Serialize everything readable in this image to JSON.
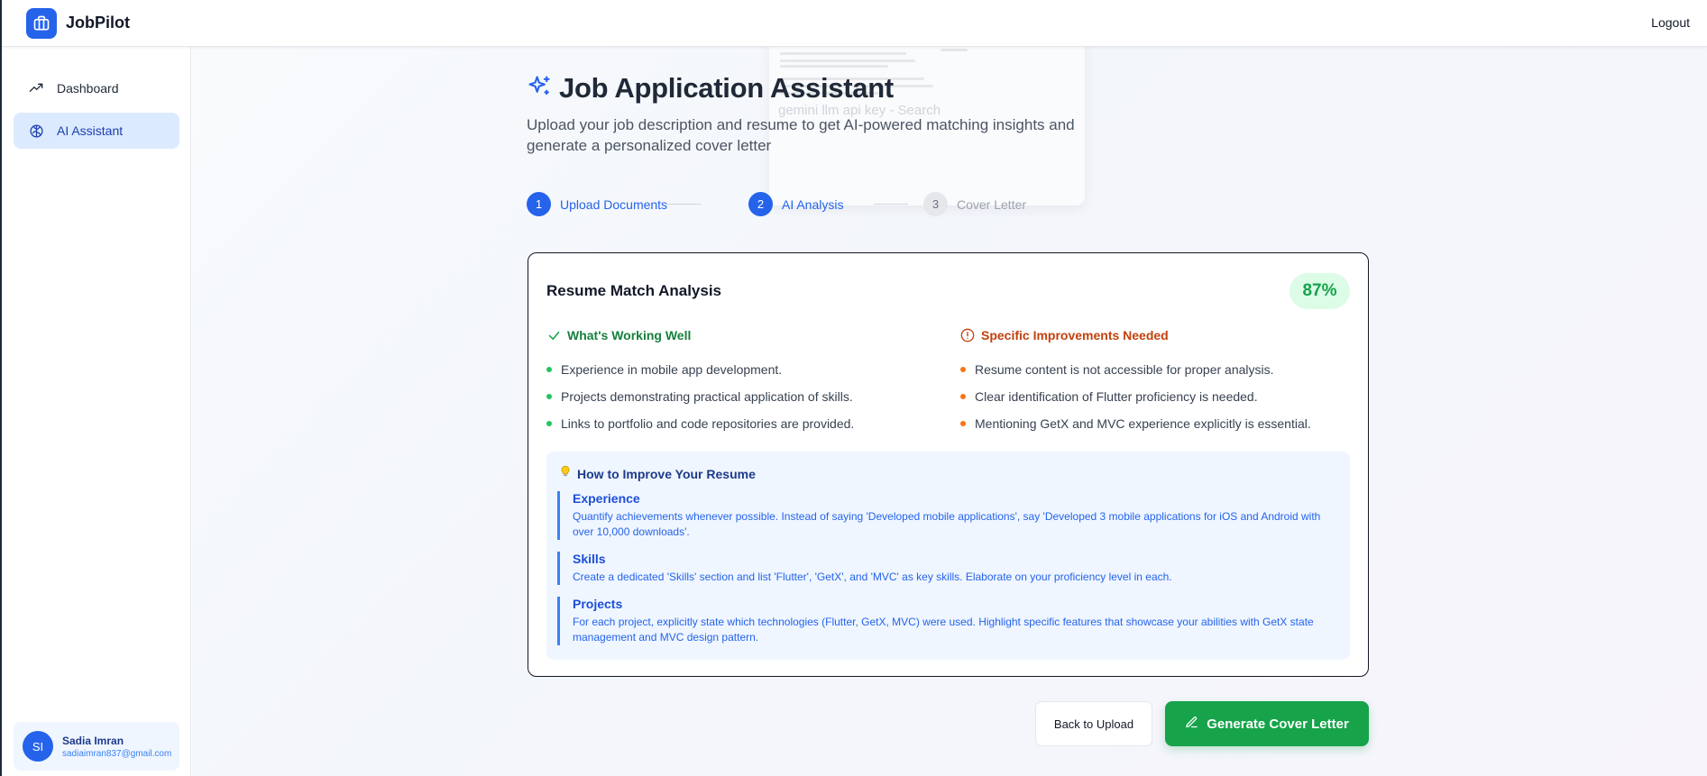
{
  "app": {
    "name": "JobPilot",
    "logout_label": "Logout"
  },
  "sidebar": {
    "items": [
      {
        "label": "Dashboard",
        "icon": "trending-up-icon",
        "active": false
      },
      {
        "label": "AI Assistant",
        "icon": "brain-icon",
        "active": true
      }
    ],
    "user": {
      "initials": "SI",
      "name": "Sadia Imran",
      "email": "sadiaimran837@gmail.com"
    }
  },
  "overlay_ghost": {
    "query_text": "gemini llm api key - Search"
  },
  "page": {
    "title": "Job Application Assistant",
    "subtitle": "Upload your job description and resume to get AI-powered matching insights and generate a personalized cover letter"
  },
  "steps": [
    {
      "number": "1",
      "label": "Upload Documents",
      "state": "active"
    },
    {
      "number": "2",
      "label": "AI Analysis",
      "state": "active"
    },
    {
      "number": "3",
      "label": "Cover Letter",
      "state": "inactive"
    }
  ],
  "analysis": {
    "title": "Resume Match Analysis",
    "score": "87%",
    "strengths": {
      "heading": "What's Working Well",
      "items": [
        "Experience in mobile app development.",
        "Projects demonstrating practical application of skills.",
        "Links to portfolio and code repositories are provided."
      ]
    },
    "improvements": {
      "heading": "Specific Improvements Needed",
      "items": [
        "Resume content is not accessible for proper analysis.",
        "Clear identification of Flutter proficiency is needed.",
        "Mentioning GetX and MVC experience explicitly is essential."
      ]
    },
    "tips": {
      "heading": "How to Improve Your Resume",
      "items": [
        {
          "title": "Experience",
          "body": "Quantify achievements whenever possible. Instead of saying 'Developed mobile applications', say 'Developed 3 mobile applications for iOS and Android with over 10,000 downloads'."
        },
        {
          "title": "Skills",
          "body": "Create a dedicated 'Skills' section and list 'Flutter', 'GetX', and 'MVC' as key skills. Elaborate on your proficiency level in each."
        },
        {
          "title": "Projects",
          "body": "For each project, explicitly state which technologies (Flutter, GetX, MVC) were used. Highlight specific features that showcase your abilities with GetX state management and MVC design pattern."
        }
      ]
    }
  },
  "actions": {
    "back_label": "Back to Upload",
    "generate_label": "Generate Cover Letter"
  },
  "colors": {
    "primary": "#2563eb",
    "success": "#16a34a",
    "warning": "#f97316",
    "tip_bg": "#eff6ff"
  }
}
